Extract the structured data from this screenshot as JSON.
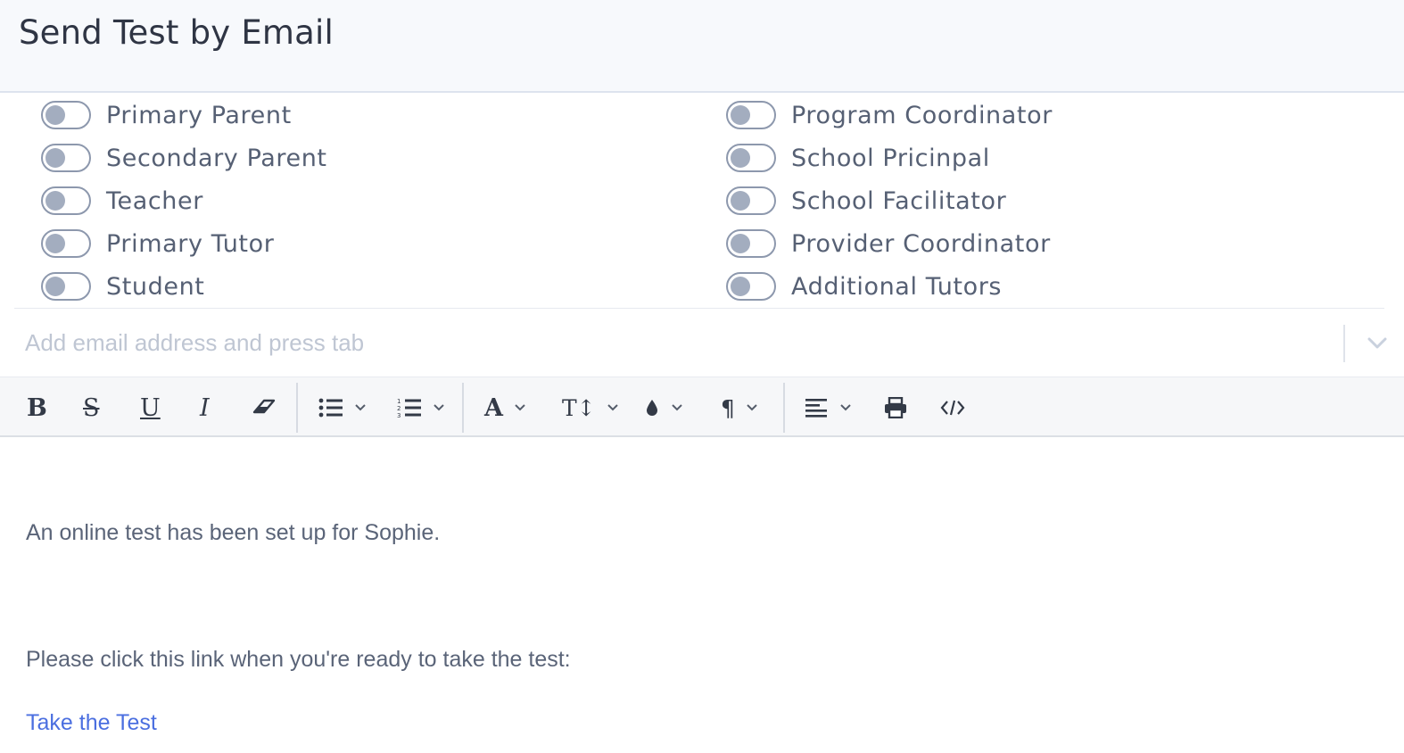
{
  "header": {
    "title": "Send Test by Email"
  },
  "recipients": {
    "left": [
      {
        "label": "Primary Parent",
        "on": false
      },
      {
        "label": "Secondary Parent",
        "on": false
      },
      {
        "label": "Teacher",
        "on": false
      },
      {
        "label": "Primary Tutor",
        "on": false
      },
      {
        "label": "Student",
        "on": false
      }
    ],
    "right": [
      {
        "label": "Program Coordinator",
        "on": false
      },
      {
        "label": "School Pricinpal",
        "on": false
      },
      {
        "label": "School Facilitator",
        "on": false
      },
      {
        "label": "Provider Coordinator",
        "on": false
      },
      {
        "label": "Additional Tutors",
        "on": false
      }
    ]
  },
  "email": {
    "placeholder": "Add email address and press tab",
    "value": ""
  },
  "toolbar": {
    "bold": "B",
    "strike": "S",
    "underline": "U",
    "italic": "I",
    "font": "A",
    "text_size": "T↕",
    "paragraph": "¶",
    "icons": [
      "bold-icon",
      "strikethrough-icon",
      "underline-icon",
      "italic-icon",
      "eraser-icon",
      "bullet-list-icon",
      "numbered-list-icon",
      "font-family-icon",
      "font-size-icon",
      "color-icon",
      "paragraph-icon",
      "align-icon",
      "print-icon",
      "code-view-icon"
    ]
  },
  "body": {
    "line1": "An online test has been set up for Sophie.",
    "line2": "Please click this link when you're ready to take the test:",
    "link": "Take the Test"
  },
  "colors": {
    "accent_link": "#4b6fe0",
    "toggle_border": "#8d98ad",
    "toggle_knob": "#a3adbf",
    "header_bg": "#f7f9fc"
  }
}
